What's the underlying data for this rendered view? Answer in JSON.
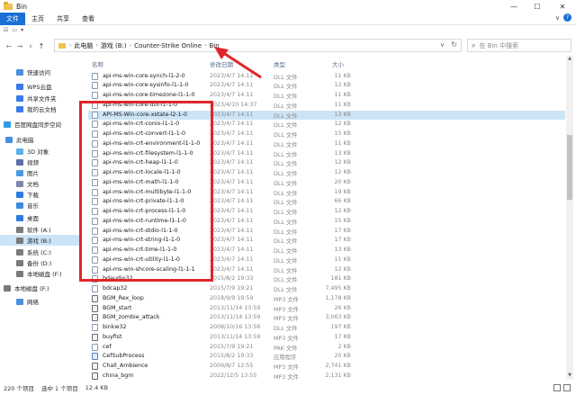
{
  "window": {
    "title": "Bin",
    "minimize": "—",
    "maximize": "☐",
    "close": "✕"
  },
  "ribbon": {
    "tabs": [
      "文件",
      "主页",
      "共享",
      "查看"
    ],
    "expand": "∨",
    "help": "?"
  },
  "nav": {
    "back": "←",
    "forward": "→",
    "recent": "∨",
    "up": "↑",
    "breadcrumbs": [
      "此电脑",
      "游戏 (B:)",
      "Counter-Strike Online",
      "Bin"
    ],
    "sep": "›",
    "dropdown": "∨",
    "refresh": "↻"
  },
  "search": {
    "placeholder": "在 Bin 中搜索"
  },
  "columns": {
    "name": "名称",
    "date": "修改日期",
    "type": "类型",
    "size": "大小"
  },
  "sidebar": [
    {
      "label": "快速访问",
      "icon": "star-icon",
      "color": "#4a8fe0"
    },
    {
      "label": "WPS云盘",
      "icon": "cloud-icon",
      "color": "#3a7be8"
    },
    {
      "label": "共享文件夹",
      "icon": "shared-folder-icon",
      "color": "#3a7be8"
    },
    {
      "label": "我的云文档",
      "icon": "cloud-doc-icon",
      "color": "#3a7be8"
    },
    {
      "label": "百度网盘同步空间",
      "icon": "baidu-cloud-icon",
      "color": "#2c9ce8"
    },
    {
      "label": "此电脑",
      "icon": "computer-icon",
      "color": "#4a8fe0"
    },
    {
      "label": "3D 对象",
      "icon": "3d-objects-icon",
      "color": "#5bb0e8"
    },
    {
      "label": "视频",
      "icon": "video-icon",
      "color": "#5a6fa8"
    },
    {
      "label": "图片",
      "icon": "picture-icon",
      "color": "#4a9ae0"
    },
    {
      "label": "文档",
      "icon": "document-icon",
      "color": "#7a8aa8"
    },
    {
      "label": "下载",
      "icon": "download-icon",
      "color": "#2c7be0"
    },
    {
      "label": "音乐",
      "icon": "music-icon",
      "color": "#3a8ae0"
    },
    {
      "label": "桌面",
      "icon": "desktop-icon",
      "color": "#2c7be0"
    },
    {
      "label": "软件 (A:)",
      "icon": "drive-icon",
      "color": "#7a7a7a"
    },
    {
      "label": "游戏 (B:)",
      "icon": "drive-icon",
      "color": "#7a7a7a"
    },
    {
      "label": "系统 (C:)",
      "icon": "system-drive-icon",
      "color": "#7a7a7a"
    },
    {
      "label": "备份 (D:)",
      "icon": "drive-icon",
      "color": "#7a7a7a"
    },
    {
      "label": "本地磁盘 (F:)",
      "icon": "drive-icon",
      "color": "#7a7a7a"
    },
    {
      "label": "本地磁盘 (F:)",
      "icon": "drive-icon",
      "color": "#7a7a7a"
    },
    {
      "label": "网络",
      "icon": "network-icon",
      "color": "#4a8fe0"
    }
  ],
  "files": [
    {
      "name": "api-ms-win-core-synch-l1-2-0",
      "date": "2023/4/7 14:11",
      "type": "DLL 文件",
      "size": "11 KB"
    },
    {
      "name": "api-ms-win-core-sysinfo-l1-1-0",
      "date": "2023/4/7 14:11",
      "type": "DLL 文件",
      "size": "12 KB"
    },
    {
      "name": "api-ms-win-core-timezone-l1-1-0",
      "date": "2023/4/7 14:11",
      "type": "DLL 文件",
      "size": "11 KB"
    },
    {
      "name": "api-ms-win-core-util-l1-1-0",
      "date": "2023/4/10 14:37",
      "type": "DLL 文件",
      "size": "11 KB"
    },
    {
      "name": "API-MS-Win-core-xstate-l2-1-0",
      "date": "2023/4/7 14:11",
      "type": "DLL 文件",
      "size": "13 KB"
    },
    {
      "name": "api-ms-win-crt-conio-l1-1-0",
      "date": "2023/4/7 14:11",
      "type": "DLL 文件",
      "size": "12 KB"
    },
    {
      "name": "api-ms-win-crt-convert-l1-1-0",
      "date": "2023/4/7 14:11",
      "type": "DLL 文件",
      "size": "15 KB"
    },
    {
      "name": "api-ms-win-crt-environment-l1-1-0",
      "date": "2023/4/7 14:11",
      "type": "DLL 文件",
      "size": "11 KB"
    },
    {
      "name": "api-ms-win-crt-filesystem-l1-1-0",
      "date": "2023/4/7 14:11",
      "type": "DLL 文件",
      "size": "13 KB"
    },
    {
      "name": "api-ms-win-crt-heap-l1-1-0",
      "date": "2023/4/7 14:11",
      "type": "DLL 文件",
      "size": "12 KB"
    },
    {
      "name": "api-ms-win-crt-locale-l1-1-0",
      "date": "2023/4/7 14:11",
      "type": "DLL 文件",
      "size": "12 KB"
    },
    {
      "name": "api-ms-win-crt-math-l1-1-0",
      "date": "2023/4/7 14:11",
      "type": "DLL 文件",
      "size": "20 KB"
    },
    {
      "name": "api-ms-win-crt-multibyte-l1-1-0",
      "date": "2023/4/7 14:11",
      "type": "DLL 文件",
      "size": "19 KB"
    },
    {
      "name": "api-ms-win-crt-private-l1-1-0",
      "date": "2023/4/7 14:11",
      "type": "DLL 文件",
      "size": "66 KB"
    },
    {
      "name": "api-ms-win-crt-process-l1-1-0",
      "date": "2023/4/7 14:11",
      "type": "DLL 文件",
      "size": "12 KB"
    },
    {
      "name": "api-ms-win-crt-runtime-l1-1-0",
      "date": "2023/4/7 14:11",
      "type": "DLL 文件",
      "size": "15 KB"
    },
    {
      "name": "api-ms-win-crt-stdio-l1-1-0",
      "date": "2023/4/7 14:11",
      "type": "DLL 文件",
      "size": "17 KB"
    },
    {
      "name": "api-ms-win-crt-string-l1-1-0",
      "date": "2023/4/7 14:11",
      "type": "DLL 文件",
      "size": "17 KB"
    },
    {
      "name": "api-ms-win-crt-time-l1-1-0",
      "date": "2023/4/7 14:11",
      "type": "DLL 文件",
      "size": "13 KB"
    },
    {
      "name": "api-ms-win-crt-utility-l1-1-0",
      "date": "2023/4/7 14:11",
      "type": "DLL 文件",
      "size": "11 KB"
    },
    {
      "name": "api-ms-win-shcore-scaling-l1-1-1",
      "date": "2023/4/7 14:11",
      "type": "DLL 文件",
      "size": "12 KB"
    },
    {
      "name": "bdaudio32",
      "date": "2015/8/2 19:33",
      "type": "DLL 文件",
      "size": "181 KB"
    },
    {
      "name": "bdcap32",
      "date": "2015/7/9 19:21",
      "type": "DLL 文件",
      "size": "7,495 KB"
    },
    {
      "name": "BGM_Rex_loop",
      "date": "2018/9/9 19:59",
      "type": "MP3 文件",
      "size": "1,178 KB"
    },
    {
      "name": "BGM_start",
      "date": "2013/11/14 13:59",
      "type": "MP3 文件",
      "size": "26 KB"
    },
    {
      "name": "BGM_zombie_attack",
      "date": "2013/11/14 13:59",
      "type": "MP3 文件",
      "size": "3,063 KB"
    },
    {
      "name": "binkw32",
      "date": "2008/10/16 13:56",
      "type": "DLL 文件",
      "size": "197 KB"
    },
    {
      "name": "buyfist",
      "date": "2013/11/14 13:59",
      "type": "MP3 文件",
      "size": "17 KB"
    },
    {
      "name": "cef",
      "date": "2015/7/9 19:21",
      "type": "PAK 文件",
      "size": "2 KB"
    },
    {
      "name": "CefSubProcess",
      "date": "2015/8/2 19:33",
      "type": "应用程序",
      "size": "20 KB"
    },
    {
      "name": "Chall_Ambience",
      "date": "2009/8/7 12:55",
      "type": "MP3 文件",
      "size": "2,741 KB"
    },
    {
      "name": "china_bgm",
      "date": "2022/12/5 13:55",
      "type": "MP3 文件",
      "size": "2,131 KB"
    }
  ],
  "status": {
    "count": "220 个项目",
    "selected": "选中 1 个项目",
    "size": "12.4 KB"
  }
}
